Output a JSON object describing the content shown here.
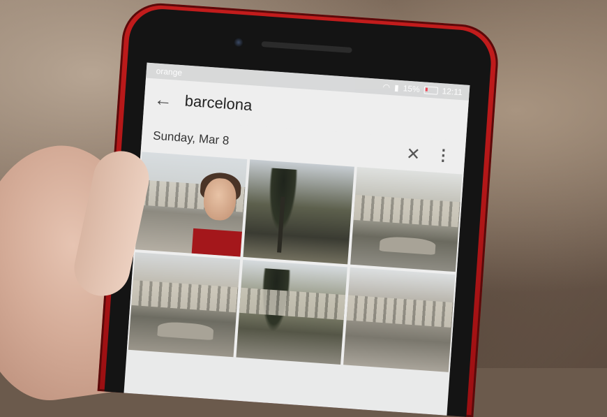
{
  "scene": {
    "statusbar": {
      "carrier": "orange",
      "battery": "15%",
      "time": "12:11"
    },
    "appbar": {
      "search_query": "barcelona"
    },
    "datebar": {
      "date_label": "Sunday, Mar 8"
    },
    "photos": [
      {
        "subject": "woman-eating-plaza"
      },
      {
        "subject": "palm-trees-sky"
      },
      {
        "subject": "plaza-arcade-fountain"
      },
      {
        "subject": "plaza-arcade-people"
      },
      {
        "subject": "palm-trees-plaza"
      },
      {
        "subject": "narrow-street"
      }
    ],
    "colors": {
      "phone_case": "#c21c1c",
      "screen_bg": "#eeeeee"
    }
  }
}
